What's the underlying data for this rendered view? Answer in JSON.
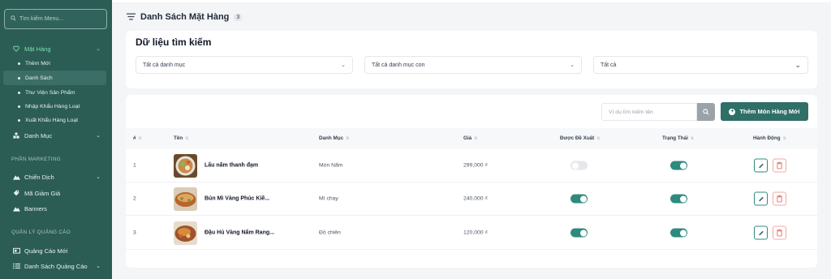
{
  "sidebar": {
    "search_placeholder": "Tìm kiếm Menu...",
    "products": {
      "label": "Mặt Hàng",
      "children": [
        "Thêm Mới",
        "Danh Sách",
        "Thư Viện Sản Phẩm",
        "Nhập Khẩu Hàng Loạt",
        "Xuất Khẩu Hàng Loạt"
      ]
    },
    "category_label": "Danh Mục",
    "marketing_section": "PHẦN MARKETING",
    "campaign_label": "Chiến Dịch",
    "coupon_label": "Mã Giảm Giá",
    "banners_label": "Banners",
    "ads_section": "QUẢN LÝ QUẢNG CÁO",
    "new_ad_label": "Quảng Cáo Mới",
    "ad_list_label": "Danh Sách Quảng Cáo"
  },
  "page": {
    "title": "Danh Sách Mặt Hàng",
    "count": "3"
  },
  "filters": {
    "title": "Dữ liệu tìm kiếm",
    "category": "Tất cả danh mục",
    "subcategory": "Tất cả danh mục con",
    "status": "Tất cả"
  },
  "toolbar": {
    "search_placeholder": "Ví dụ tìm kiếm tên",
    "add_label": "Thêm Món Hàng Mới"
  },
  "table": {
    "headers": [
      "#",
      "Tên",
      "Danh Mục",
      "Giá",
      "Được Đề Xuất",
      "Trạng Thái",
      "Hành Động"
    ],
    "rows": [
      {
        "index": "1",
        "name": "Lẩu nấm thanh đạm",
        "category": "Món Nấm",
        "price": "299,000 ₫",
        "featured": false,
        "active": true
      },
      {
        "index": "2",
        "name": "Bún Mì Vàng Phúc Kiế...",
        "category": "Mì chay",
        "price": "240,000 ₫",
        "featured": true,
        "active": true
      },
      {
        "index": "3",
        "name": "Đậu Hủ Vàng Nấm Rang...",
        "category": "Đồ chiên",
        "price": "120,000 ₫",
        "featured": true,
        "active": true
      }
    ]
  },
  "colors": {
    "sidebar_bg": "#2b5d55",
    "accent": "#2f6f68",
    "active_menu": "#7fe0b0",
    "toggle_on": "#2f8a7e",
    "delete": "#e57368"
  }
}
